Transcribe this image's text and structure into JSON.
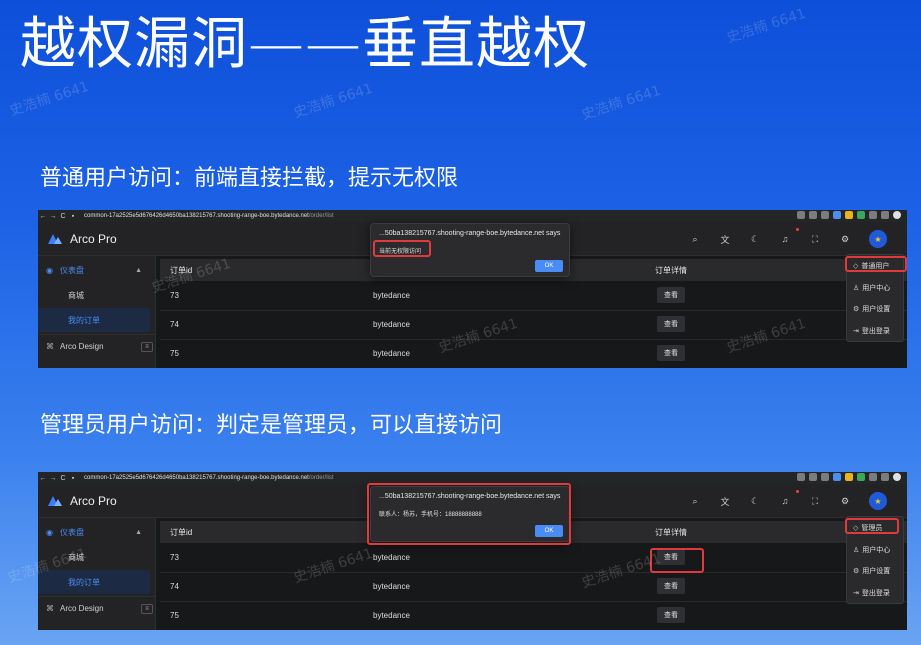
{
  "slide": {
    "title": "越权漏洞——垂直越权",
    "caption_normal": "普通用户访问：前端直接拦截，提示无权限",
    "caption_admin": "管理员用户访问：判定是管理员，可以直接访问",
    "watermark": "史浩楠 6641"
  },
  "browser": {
    "url_host": "common-17a2525e5d676426d4650ba138215767.shooting-range-boe.bytedance.net",
    "url_path": "/order/list"
  },
  "app": {
    "brand": "Arco Pro",
    "sidebar": {
      "dashboard": "仪表盘",
      "mall": "商城",
      "my_orders": "我的订单",
      "arco_design": "Arco Design"
    },
    "table": {
      "col_order_id": "订单id",
      "col_detail": "订单详情",
      "view_label": "查看",
      "rows": [
        {
          "id": "73",
          "name": "bytedance"
        },
        {
          "id": "74",
          "name": "bytedance"
        },
        {
          "id": "75",
          "name": "bytedance"
        }
      ]
    },
    "user_menu": {
      "normal_role": "普通用户",
      "admin_role": "管理员",
      "user_center": "用户中心",
      "user_settings": "用户设置",
      "logout": "登出登录"
    }
  },
  "dialog_normal": {
    "title": "...50ba138215767.shooting-range-boe.bytedance.net says",
    "message": "当前无权限访问",
    "ok": "OK"
  },
  "dialog_admin": {
    "title": "...50ba138215767.shooting-range-boe.bytedance.net says",
    "message": "联系人：杨苏，手机号：18888888888",
    "ok": "OK"
  },
  "colors": {
    "accent": "#4c8df6",
    "highlight": "#e0393e",
    "slide_bg_top": "#0e4fd9"
  }
}
